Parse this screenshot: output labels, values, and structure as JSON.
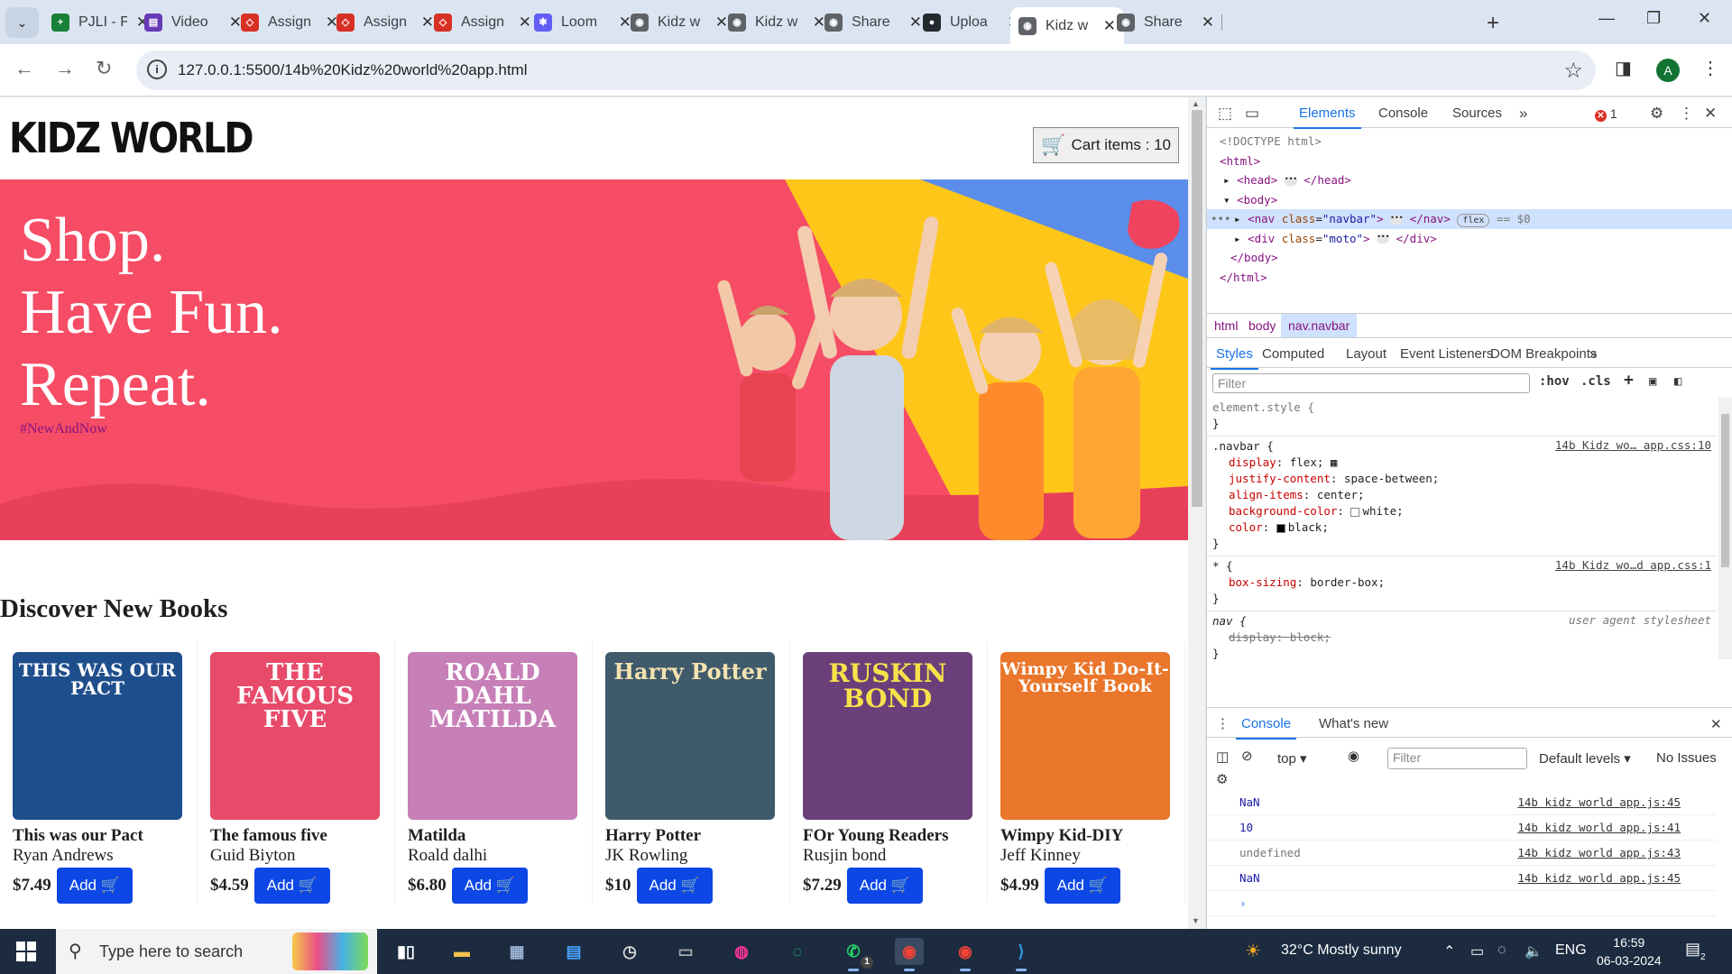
{
  "browser": {
    "tabs": [
      {
        "title": "PJLI - F",
        "color": "#188038",
        "glyph": "+"
      },
      {
        "title": "Video",
        "color": "#673ab7",
        "glyph": "▤"
      },
      {
        "title": "Assign",
        "color": "#d93025",
        "glyph": "◇"
      },
      {
        "title": "Assign",
        "color": "#d93025",
        "glyph": "◇"
      },
      {
        "title": "Assign",
        "color": "#d93025",
        "glyph": "◇"
      },
      {
        "title": "Loom",
        "color": "#625df5",
        "glyph": "✱"
      },
      {
        "title": "Kidz w",
        "color": "#5f6368",
        "glyph": "◉"
      },
      {
        "title": "Kidz w",
        "color": "#5f6368",
        "glyph": "◉"
      },
      {
        "title": "Share",
        "color": "#5f6368",
        "glyph": "◉"
      },
      {
        "title": "Uploa",
        "color": "#24292f",
        "glyph": "●"
      },
      {
        "title": "Kidz w",
        "color": "#5f6368",
        "glyph": "◉",
        "active": true
      },
      {
        "title": "Share",
        "color": "#5f6368",
        "glyph": "◉"
      }
    ],
    "url": "127.0.0.1:5500/14b%20Kidz%20world%20app.html",
    "profile_initial": "A"
  },
  "site": {
    "logo": "KIDZ WORLD",
    "cart_label": "Cart items : 10",
    "hero": {
      "lines": [
        "Shop.",
        "Have Fun.",
        "Repeat."
      ],
      "hashtag": "#NewAndNow"
    },
    "section_title": "Discover New Books",
    "add_label": "Add",
    "books": [
      {
        "title": "This was our Pact",
        "author": "Ryan Andrews",
        "price": "$7.49",
        "cover_text": "THIS WAS OUR PACT",
        "cover_bg": "#1f4e8c",
        "cover_fg": "#ffffff",
        "size": "20px"
      },
      {
        "title": "The famous five",
        "author": "Guid Biyton",
        "price": "$4.59",
        "cover_text": "THE FAMOUS FIVE",
        "cover_bg": "#e84a6a",
        "cover_fg": "#ffffff",
        "size": "26px"
      },
      {
        "title": "Matilda",
        "author": "Roald dalhi",
        "price": "$6.80",
        "cover_text": "ROALD DAHL MATILDA",
        "cover_bg": "#c77fb7",
        "cover_fg": "#ffffff",
        "size": "26px"
      },
      {
        "title": "Harry Potter",
        "author": "JK Rowling",
        "price": "$10",
        "cover_text": "Harry Potter",
        "cover_bg": "#3f5a6b",
        "cover_fg": "#f4e3b0",
        "size": "24px"
      },
      {
        "title": "FOr Young Readers",
        "author": "Rusjin bond",
        "price": "$7.29",
        "cover_text": "RUSKIN BOND",
        "cover_bg": "#6b3f7a",
        "cover_fg": "#f7e24a",
        "size": "28px"
      },
      {
        "title": "Wimpy Kid-DIY",
        "author": "Jeff Kinney",
        "price": "$4.99",
        "cover_text": "Wimpy Kid Do-It-Yourself Book",
        "cover_bg": "#e9762b",
        "cover_fg": "#ffffff",
        "size": "19px"
      }
    ]
  },
  "devtools": {
    "tabs": [
      "Elements",
      "Console",
      "Sources"
    ],
    "error_count": "1",
    "dom": {
      "doctype": "<!DOCTYPE html>",
      "html_open": "<html>",
      "head": "<head>",
      "head_close": "</head>",
      "body": "<body>",
      "nav_tag": "<nav ",
      "nav_attr": "class",
      "nav_val": "\"navbar\"",
      "nav_close": "</nav>",
      "nav_pill": "flex",
      "nav_sel": "== $0",
      "div_tag": "<div ",
      "div_attr": "class",
      "div_val": "\"moto\"",
      "div_close": "</div>",
      "body_close": "</body>",
      "html_close": "</html>"
    },
    "breadcrumbs": [
      "html",
      "body",
      "nav.navbar"
    ],
    "styles_tabs": [
      "Styles",
      "Computed",
      "Layout",
      "Event Listeners",
      "DOM Breakpoints"
    ],
    "filter_placeholder": "Filter",
    "hov": ":hov",
    "cls": ".cls",
    "rules": {
      "element": "element.style {",
      "close": "}",
      "navbar_sel": ".navbar {",
      "navbar_src": "14b Kidz wo… app.css:10",
      "navbar_props": [
        {
          "name": "display",
          "value": "flex;"
        },
        {
          "name": "justify-content",
          "value": "space-between;"
        },
        {
          "name": "align-items",
          "value": "center;"
        },
        {
          "name": "background-color",
          "value": "white;"
        },
        {
          "name": "color",
          "value": "black;"
        }
      ],
      "star_sel": "* {",
      "star_src": "14b Kidz wo…d app.css:1",
      "star_prop": {
        "name": "box-sizing",
        "value": "border-box;"
      },
      "nav_sel": "nav {",
      "nav_src": "user agent stylesheet",
      "nav_prop": {
        "name": "display",
        "value": "block;"
      }
    },
    "drawer_tabs": [
      "Console",
      "What's new"
    ],
    "console": {
      "context": "top",
      "filter_placeholder": "Filter",
      "levels": "Default levels",
      "issues": "No Issues",
      "logs": [
        {
          "value": "NaN",
          "src": "14b kidz world app.js:45",
          "kind": "num"
        },
        {
          "value": "10",
          "src": "14b kidz world app.js:41",
          "kind": "num"
        },
        {
          "value": "undefined",
          "src": "14b kidz world app.js:43",
          "kind": "undef"
        },
        {
          "value": "NaN",
          "src": "14b kidz world app.js:45",
          "kind": "num"
        }
      ],
      "prompt": "›"
    }
  },
  "taskbar": {
    "search_placeholder": "Type here to search",
    "weather": "32°C  Mostly sunny",
    "language": "ENG",
    "time": "16:59",
    "date": "06-03-2024",
    "notif_count": "2",
    "whatsapp_badge": "1"
  }
}
